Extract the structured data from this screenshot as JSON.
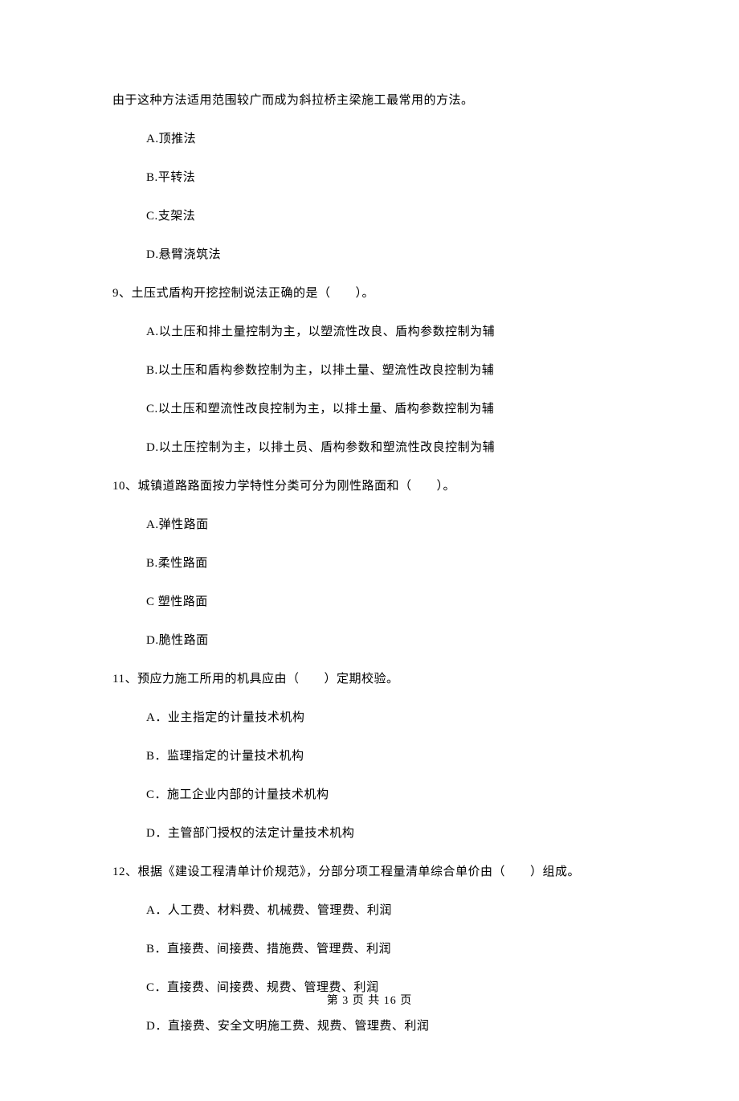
{
  "intro": "由于这种方法适用范围较广而成为斜拉桥主梁施工最常用的方法。",
  "q8_options": {
    "a": "A.顶推法",
    "b": "B.平转法",
    "c": "C.支架法",
    "d": "D.悬臂浇筑法"
  },
  "q9": {
    "stem": "9、土压式盾构开挖控制说法正确的是（　　）。",
    "a": "A.以土压和排土量控制为主，以塑流性改良、盾构参数控制为辅",
    "b": "B.以土压和盾构参数控制为主，以排土量、塑流性改良控制为辅",
    "c": "C.以土压和塑流性改良控制为主，以排土量、盾构参数控制为辅",
    "d": "D.以土压控制为主，以排土员、盾构参数和塑流性改良控制为辅"
  },
  "q10": {
    "stem": "10、城镇道路路面按力学特性分类可分为刚性路面和（　　）。",
    "a": "A.弹性路面",
    "b": "B.柔性路面",
    "c": "C 塑性路面",
    "d": "D.脆性路面"
  },
  "q11": {
    "stem": "11、预应力施工所用的机具应由（　　）定期校验。",
    "a": "A．业主指定的计量技术机构",
    "b": "B．监理指定的计量技术机构",
    "c": "C．施工企业内部的计量技术机构",
    "d": "D．主管部门授权的法定计量技术机构"
  },
  "q12": {
    "stem": "12、根据《建设工程清单计价规范》，分部分项工程量清单综合单价由（　　）组成。",
    "a": "A．人工费、材料费、机械费、管理费、利润",
    "b": "B．直接费、间接费、措施费、管理费、利润",
    "c": "C．直接费、间接费、规费、管理费、利润",
    "d": "D．直接费、安全文明施工费、规费、管理费、利润"
  },
  "footer": "第 3 页 共 16 页"
}
